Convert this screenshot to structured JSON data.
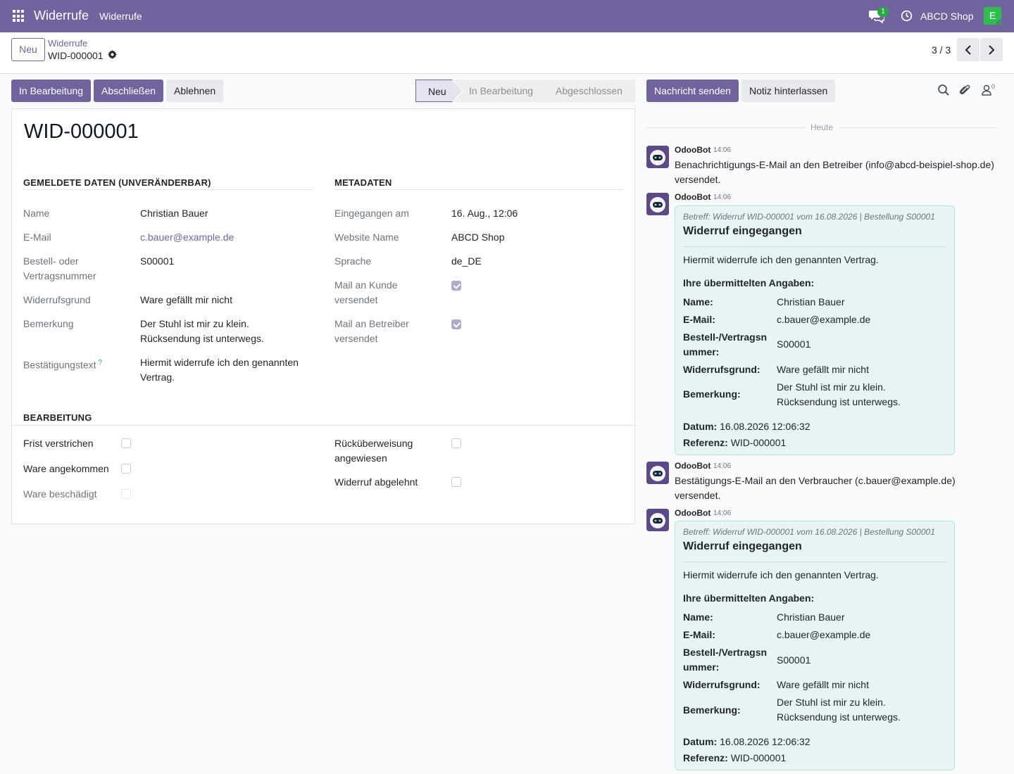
{
  "navbar": {
    "brand": "Widerrufe",
    "menu": "Widerrufe",
    "chat_badge": "1",
    "company": "ABCD Shop",
    "user_initial": "E",
    "bg_color": "#71639e"
  },
  "control_panel": {
    "new_label": "Neu",
    "breadcrumb_parent": "Widerrufe",
    "breadcrumb_current": "WID-000001",
    "pager": "3 / 3"
  },
  "actions": {
    "in_bearbeitung": "In Bearbeitung",
    "abschliessen": "Abschließen",
    "ablehnen": "Ablehnen"
  },
  "statusbar": {
    "stages": [
      "Neu",
      "In Bearbeitung",
      "Abgeschlossen"
    ],
    "active": "Neu"
  },
  "form": {
    "title": "WID-000001",
    "reported": {
      "heading": "GEMELDETE DATEN (UNVERÄNDERBAR)",
      "name_label": "Name",
      "name": "Christian Bauer",
      "email_label": "E-Mail",
      "email": "c.bauer@example.de",
      "order_label_1": "Bestell- oder",
      "order_label_2": "Vertragsnummer",
      "order": "S00001",
      "reason_label": "Widerrufsgrund",
      "reason": "Ware gefällt mir nicht",
      "remark_label": "Bemerkung",
      "remark_1": "Der Stuhl ist mir zu klein.",
      "remark_2": "Rücksendung ist unterwegs.",
      "confirm_label": "Bestätigungstext",
      "help_mark": "?",
      "confirm_1": "Hiermit widerrufe ich den genannten",
      "confirm_2": "Vertrag."
    },
    "meta": {
      "heading": "METADATEN",
      "received_label": "Eingegangen am",
      "received": "16. Aug., 12:06",
      "website_label": "Website Name",
      "website": "ABCD Shop",
      "lang_label": "Sprache",
      "lang": "de_DE",
      "mail_customer_label_1": "Mail an Kunde",
      "mail_customer_label_2": "versendet",
      "mail_customer": true,
      "mail_operator_label_1": "Mail an Betreiber",
      "mail_operator_label_2": "versendet",
      "mail_operator": true
    },
    "processing": {
      "heading": "BEARBEITUNG",
      "deadline_label": "Frist verstrichen",
      "arrived_label": "Ware angekommen",
      "damaged_label": "Ware beschädigt",
      "refund_label_1": "Rücküberweisung",
      "refund_label_2": "angewiesen",
      "rejected_label": "Widerruf abgelehnt"
    }
  },
  "chatter": {
    "send_message": "Nachricht senden",
    "log_note": "Notiz hinterlassen",
    "followers": "0",
    "day": "Heute",
    "messages": [
      {
        "author": "OdooBot",
        "time": "14:06",
        "line1": "Benachrichtigungs-E-Mail an den Betreiber (info@abcd-beispiel-shop.de)",
        "line2": "versendet."
      },
      {
        "author": "OdooBot",
        "time": "14:06",
        "subject": "Betreff: Widerruf WID-000001 vom 16.08.2026 | Bestellung S00001",
        "heading": "Widerruf eingegangen",
        "intro": "Hiermit widerrufe ich den genannten Vertrag.",
        "data_heading": "Ihre übermittelten Angaben:",
        "name_key": "Name:",
        "name": "Christian Bauer",
        "email_key": "E-Mail:",
        "email": "c.bauer@example.de",
        "order_key_1": "Bestell-/Vertragsn",
        "order_key_2": "ummer:",
        "order": "S00001",
        "reason_key": "Widerrufsgrund:",
        "reason": "Ware gefällt mir nicht",
        "remark_key": "Bemerkung:",
        "remark_1": "Der Stuhl ist mir zu klein.",
        "remark_2": "Rücksendung ist unterwegs.",
        "date_key": "Datum:",
        "date": "16.08.2026 12:06:32",
        "ref_key": "Referenz:",
        "ref": "WID-000001"
      },
      {
        "author": "OdooBot",
        "time": "14:06",
        "line1": "Bestätigungs-E-Mail an den Verbraucher (c.bauer@example.de)",
        "line2": "versendet."
      },
      {
        "author": "OdooBot",
        "time": "14:06",
        "subject": "Betreff: Widerruf WID-000001 vom 16.08.2026 | Bestellung S00001",
        "heading": "Widerruf eingegangen",
        "intro": "Hiermit widerrufe ich den genannten Vertrag.",
        "data_heading": "Ihre übermittelten Angaben:",
        "name_key": "Name:",
        "name": "Christian Bauer",
        "email_key": "E-Mail:",
        "email": "c.bauer@example.de",
        "order_key_1": "Bestell-/Vertragsn",
        "order_key_2": "ummer:",
        "order": "S00001",
        "reason_key": "Widerrufsgrund:",
        "reason": "Ware gefällt mir nicht",
        "remark_key": "Bemerkung:",
        "remark_1": "Der Stuhl ist mir zu klein.",
        "remark_2": "Rücksendung ist unterwegs.",
        "date_key": "Datum:",
        "date": "16.08.2026 12:06:32",
        "ref_key": "Referenz:",
        "ref": "WID-000001"
      }
    ]
  }
}
